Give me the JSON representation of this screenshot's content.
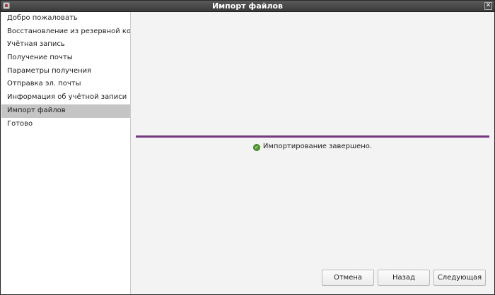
{
  "window": {
    "title": "Импорт файлов",
    "close_glyph": "✕"
  },
  "sidebar": {
    "items": [
      {
        "label": "Добро пожаловать"
      },
      {
        "label": "Восстановление из резервной копии"
      },
      {
        "label": "Учётная запись"
      },
      {
        "label": "Получение почты"
      },
      {
        "label": "Параметры получения"
      },
      {
        "label": "Отправка эл. почты"
      },
      {
        "label": "Информация об учётной записи"
      },
      {
        "label": "Импорт файлов"
      },
      {
        "label": "Готово"
      }
    ],
    "active_index": 7
  },
  "main": {
    "progress": {
      "value": 1.0,
      "color": "#7b3a86"
    },
    "status_text": "Импортирование завершено.",
    "status_icon": "success-check-icon"
  },
  "buttons": {
    "cancel": "Отмена",
    "back": "Назад",
    "next": "Следующая"
  }
}
